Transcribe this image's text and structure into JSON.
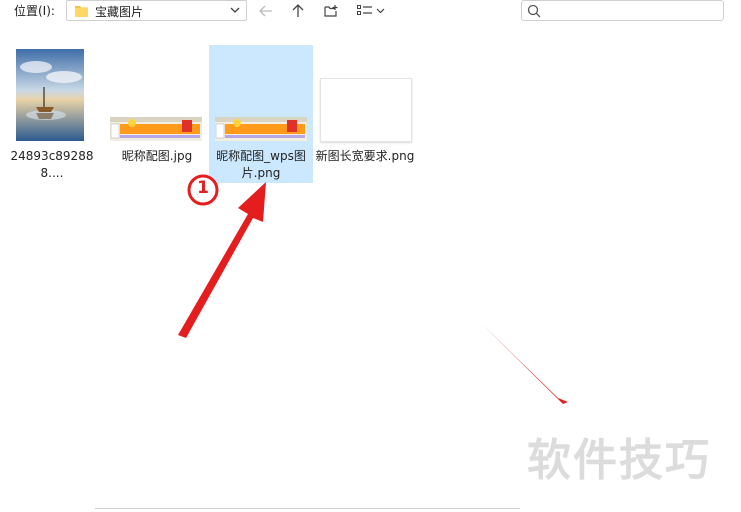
{
  "location": {
    "label": "位置(I):",
    "path": "宝藏图片"
  },
  "search": {
    "placeholder": ""
  },
  "files": [
    {
      "name": "24893c892888....",
      "thumb": "photo-sailboat"
    },
    {
      "name": "昵称配图.jpg",
      "thumb": "banner-image"
    },
    {
      "name": "昵称配图_wps图片.png",
      "name_line1": "昵称配图_wps图",
      "name_line2": "片.png",
      "thumb": "banner-image",
      "selected": true
    },
    {
      "name": "新图长宽要求.png",
      "thumb": "blank-image"
    }
  ],
  "annotation": {
    "badge": "1",
    "color": "#e02020"
  },
  "watermark": "软件技巧"
}
